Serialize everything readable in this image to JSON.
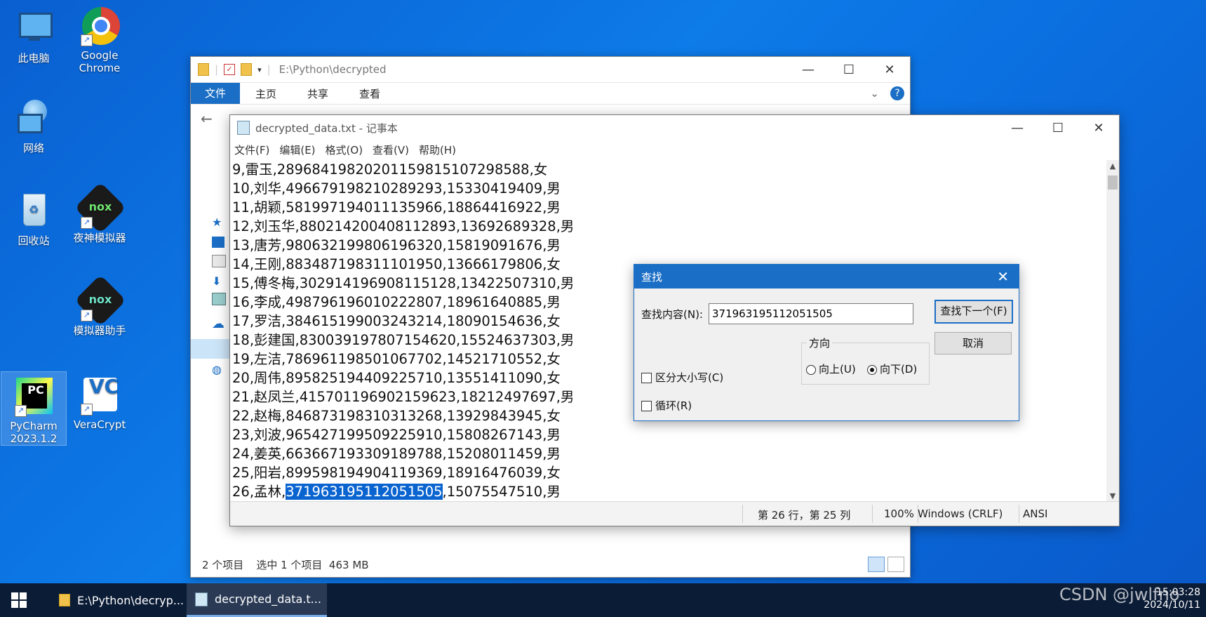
{
  "desktop": {
    "icons": [
      {
        "label": "此电脑"
      },
      {
        "label": "Google Chrome"
      },
      {
        "label": "网络"
      },
      {
        "label": "回收站"
      },
      {
        "label": "夜神模拟器"
      },
      {
        "label": "模拟器助手"
      },
      {
        "label": "PyCharm 2023.1.2"
      },
      {
        "label": "VeraCrypt"
      }
    ]
  },
  "explorer": {
    "path": "E:\\Python\\decrypted",
    "tabs": [
      "文件",
      "主页",
      "共享",
      "查看"
    ],
    "status_items": "2 个项目",
    "status_selected": "选中 1 个项目  463 MB"
  },
  "notepad": {
    "title": "decrypted_data.txt - 记事本",
    "menu": [
      "文件(F)",
      "编辑(E)",
      "格式(O)",
      "查看(V)",
      "帮助(H)"
    ],
    "lines": [
      "9,雷玉,28968419820201159815107298588,女",
      "10,刘华,496679198210289293,15330419409,男",
      "11,胡颖,581997194011135966,18864416922,男",
      "12,刘玉华,880214200408112893,13692689328,男",
      "13,唐芳,980632199806196320,15819091676,男",
      "14,王刚,883487198311101950,13666179806,女",
      "15,傅冬梅,302914196908115128,13422507310,男",
      "16,李成,498796196010222807,18961640885,男",
      "17,罗洁,384615199003243214,18090154636,女",
      "18,彭建国,830039197807154620,15524637303,男",
      "19,左洁,786961198501067702,14521710552,女",
      "20,周伟,895825194409225710,13551411090,女",
      "21,赵凤兰,415701196902159623,18212497697,男",
      "22,赵梅,846873198310313268,13929843945,女",
      "23,刘波,965427199509225910,15808267143,男",
      "24,姜英,663667193309189788,15208011459,男",
      "25,阳岩,899598194904119369,18916476039,女"
    ],
    "hl_line": {
      "prefix": "26,孟林,",
      "match": "371963195112051505",
      "suffix": ",15075547510,男"
    },
    "status": {
      "position": "第 26 行，第 25 列",
      "zoom": "100%",
      "eol": "Windows (CRLF)",
      "encoding": "ANSI"
    }
  },
  "find_dialog": {
    "title": "查找",
    "find_label": "查找内容(N):",
    "find_value": "371963195112051505",
    "find_next": "查找下一个(F)",
    "cancel": "取消",
    "direction_label": "方向",
    "up": "向上(U)",
    "down": "向下(D)",
    "match_case": "区分大小写(C)",
    "wrap": "循环(R)"
  },
  "taskbar": {
    "items": [
      "E:\\Python\\decryp...",
      "decrypted_data.t..."
    ],
    "time": "15:03:28",
    "date": "2024/10/11"
  },
  "watermark": "CSDN @jwlfno"
}
